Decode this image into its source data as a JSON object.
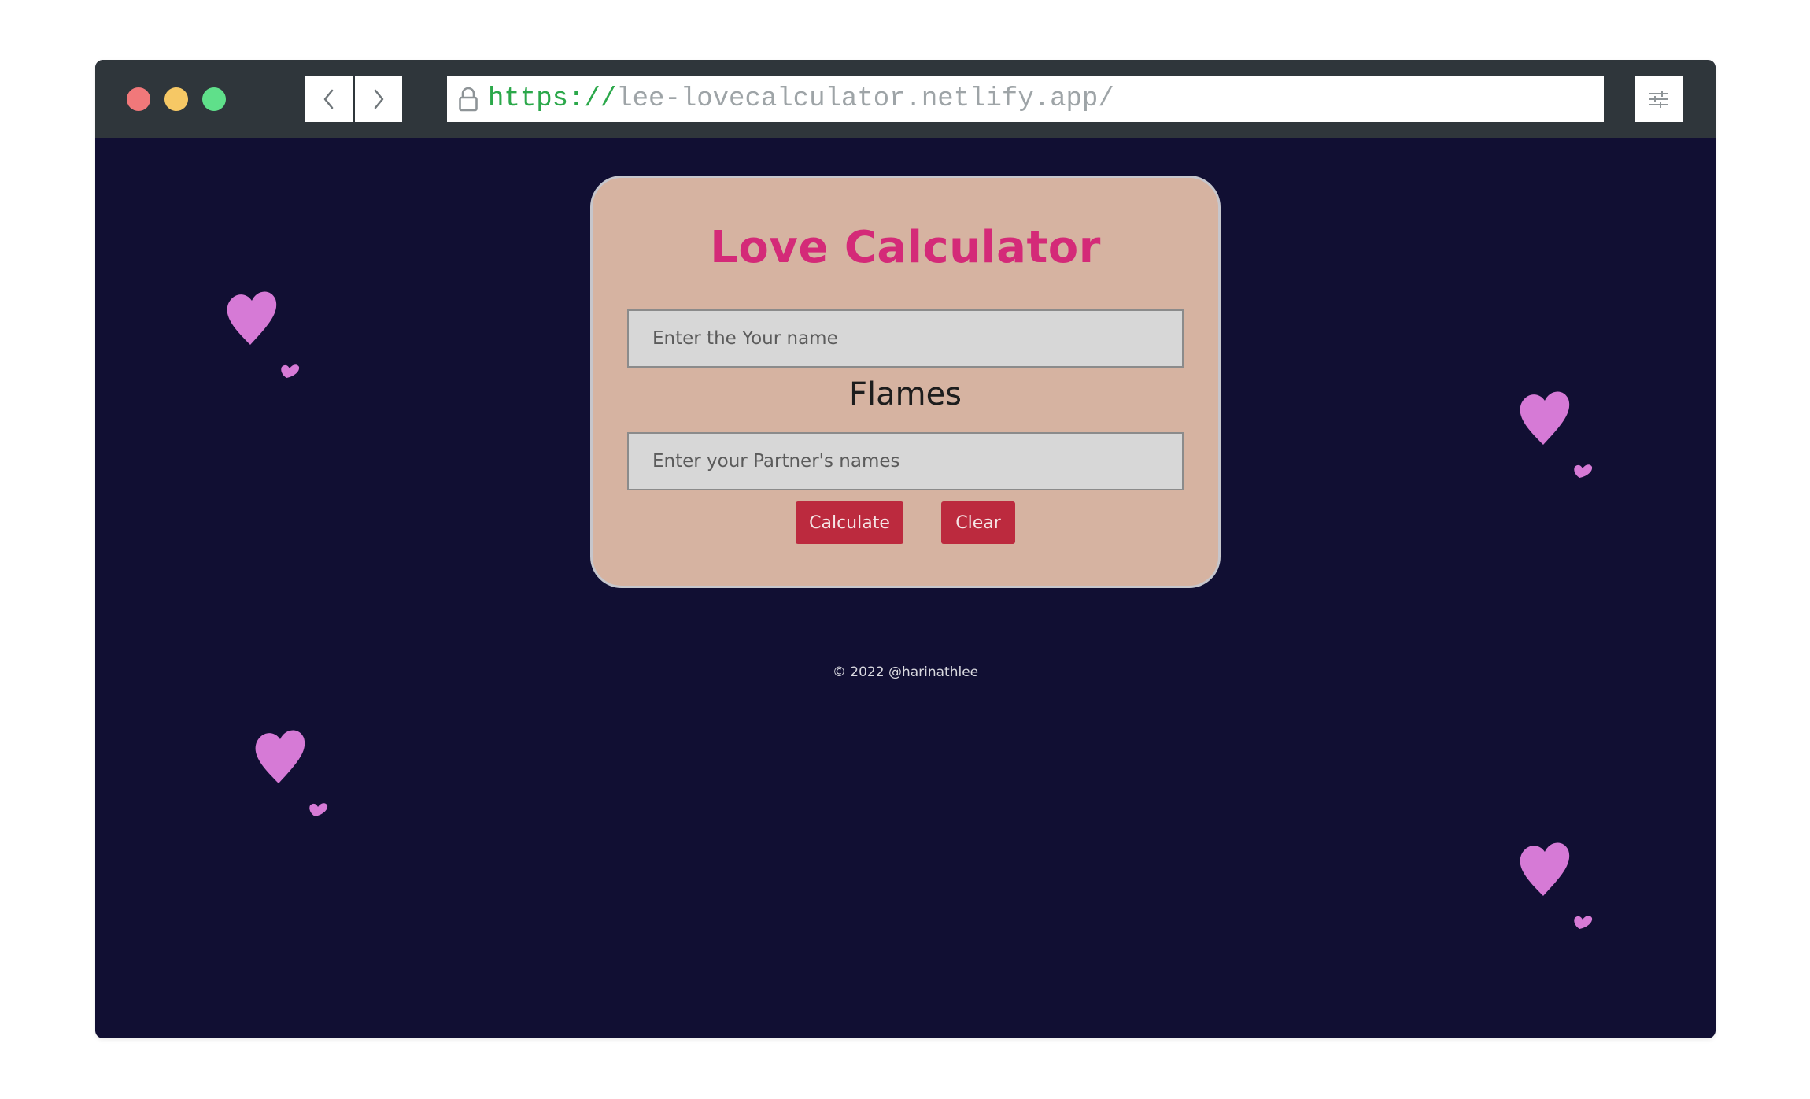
{
  "browser": {
    "url_scheme": "https://",
    "url_host": "lee-lovecalculator.netlify.app/"
  },
  "app": {
    "title": "Love Calculator",
    "name_placeholder": "Enter the Your name",
    "middle_label": "Flames",
    "partner_placeholder": "Enter your Partner's names",
    "calculate_label": "Calculate",
    "clear_label": "Clear",
    "footer": "© 2022 @harinathlee"
  },
  "colors": {
    "page_bg": "#110f33",
    "card_bg": "#d6b3a1",
    "title": "#d42a78",
    "button": "#bc2a3e",
    "heart": "#d67ad6"
  },
  "icons": [
    "lock-icon",
    "chevron-left-icon",
    "chevron-right-icon",
    "sliders-icon",
    "heart-icon"
  ]
}
